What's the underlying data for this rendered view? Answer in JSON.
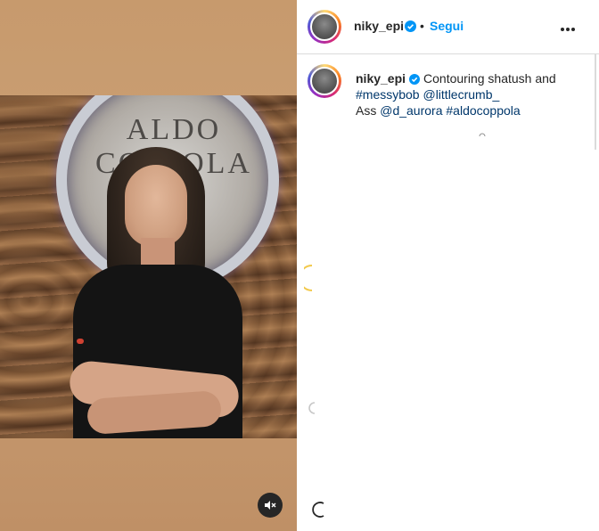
{
  "post": {
    "username": "niky_epi",
    "separator": "•",
    "follow_label": "Segui",
    "caption": {
      "username": "niky_epi",
      "text1": "Contouring shatush and",
      "tag_messybob": "#messybob",
      "tag_littlecrumb": "@littlecrumb_",
      "text2": "Ass",
      "tag_d_aurora": "@d_aurora",
      "tag_aldocoppola": "#aldocoppola"
    }
  },
  "media": {
    "sign_text_1": "ALDO",
    "sign_text_2": "COPPOLA",
    "mute_icon": "speaker-muted-icon"
  },
  "icons": {
    "verified": "verified-badge-icon",
    "more": "more-options-icon"
  },
  "colors": {
    "follow_blue": "#0095f6",
    "verified_blue": "#0095f6",
    "hashtag": "#00376b"
  }
}
